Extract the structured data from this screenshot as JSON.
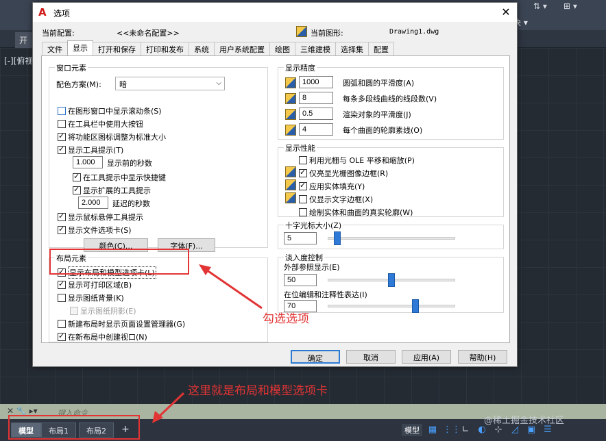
{
  "cad": {
    "start_tab": "开",
    "view_label": "[-][俯视",
    "right_label": "块 ▾",
    "command_placeholder": "键入命令",
    "watermark": "@稀土掘金技术社区"
  },
  "layout_tabs": [
    "模型",
    "布局1",
    "布局2"
  ],
  "layout_add": "+",
  "status": {
    "model": "模型"
  },
  "dialog": {
    "title": "选项",
    "current_profile_label": "当前配置:",
    "current_profile_value": "<<未命名配置>>",
    "current_drawing_label": "当前图形:",
    "current_drawing_value": "Drawing1.dwg",
    "tabs": [
      "文件",
      "显示",
      "打开和保存",
      "打印和发布",
      "系统",
      "用户系统配置",
      "绘图",
      "三维建模",
      "选择集",
      "配置"
    ],
    "active_tab": "显示",
    "window_elements": {
      "legend": "窗口元素",
      "color_scheme_label": "配色方案(M):",
      "color_scheme_value": "暗",
      "items": [
        {
          "label": "在图形窗口中显示滚动条(S)",
          "checked": false
        },
        {
          "label": "在工具栏中使用大按钮",
          "checked": false
        },
        {
          "label": "将功能区图标调整为标准大小",
          "checked": true
        },
        {
          "label": "显示工具提示(T)",
          "checked": true
        }
      ],
      "seconds_before_value": "1.000",
      "seconds_before_label": "显示前的秒数",
      "show_shortcut_label": "在工具提示中显示快捷键",
      "show_extended_label": "显示扩展的工具提示",
      "delay_value": "2.000",
      "delay_label": "延迟的秒数",
      "rollover_label": "显示鼠标悬停工具提示",
      "file_tabs_label": "显示文件选项卡(S)",
      "colors_button": "颜色(C)...",
      "fonts_button": "字体(F)..."
    },
    "layout_elements": {
      "legend": "布局元素",
      "items": [
        {
          "label": "显示布局和模型选项卡(L)",
          "checked": true
        },
        {
          "label": "显示可打印区域(B)",
          "checked": true
        },
        {
          "label": "显示图纸背景(K)",
          "checked": false
        },
        {
          "label": "显示图纸阴影(E)",
          "checked": false,
          "disabled": true
        },
        {
          "label": "新建布局时显示页面设置管理器(G)",
          "checked": false
        },
        {
          "label": "在新布局中创建视口(N)",
          "checked": true
        }
      ]
    },
    "display_resolution": {
      "legend": "显示精度",
      "items": [
        {
          "value": "1000",
          "label": "圆弧和圆的平滑度(A)"
        },
        {
          "value": "8",
          "label": "每条多段线曲线的线段数(V)"
        },
        {
          "value": "0.5",
          "label": "渲染对象的平滑度(J)"
        },
        {
          "value": "4",
          "label": "每个曲面的轮廓素线(O)"
        }
      ]
    },
    "display_performance": {
      "legend": "显示性能",
      "items": [
        {
          "label": "利用光栅与 OLE 平移和缩放(P)",
          "checked": false
        },
        {
          "label": "仅亮显光栅图像边框(R)",
          "checked": true
        },
        {
          "label": "应用实体填充(Y)",
          "checked": true
        },
        {
          "label": "仅显示文字边框(X)",
          "checked": false
        },
        {
          "label": "绘制实体和曲面的真实轮廓(W)",
          "checked": false
        }
      ]
    },
    "crosshair": {
      "legend": "十字光标大小(Z)",
      "value": "5",
      "level": 5
    },
    "fade": {
      "legend": "淡入度控制",
      "xref_label": "外部参照显示(E)",
      "xref_value": "50",
      "xref_level": 50,
      "inplace_label": "在位编辑和注释性表达(I)",
      "inplace_value": "70",
      "inplace_level": 70
    },
    "buttons": {
      "ok": "确定",
      "cancel": "取消",
      "apply": "应用(A)",
      "help": "帮助(H)"
    }
  },
  "annotations": {
    "check_option": "勾选选项",
    "this_is_tabs": "这里就是布局和模型选项卡"
  },
  "colors": {
    "annotation": "#e23434",
    "accent": "#2e7ad6"
  }
}
